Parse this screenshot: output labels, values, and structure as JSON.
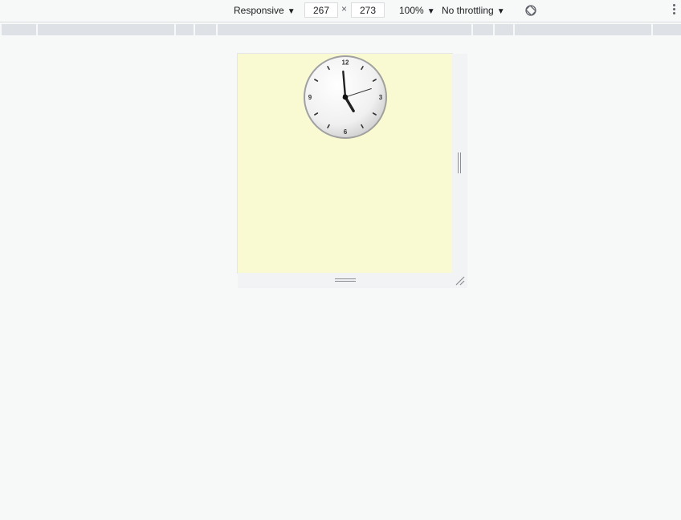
{
  "toolbar": {
    "device_mode": "Responsive",
    "width_value": "267",
    "height_value": "273",
    "times_sign": "×",
    "zoom": "100%",
    "throttling": "No throttling",
    "caret": "▼"
  },
  "icons": {
    "rotate": "rotate-icon",
    "more": "more-options-icon",
    "resize_corner": "resize-corner-icon"
  },
  "colors": {
    "page_background": "#fafad2",
    "devtools_background": "#f7f8f8",
    "media_bar": "#dee1e6"
  },
  "clock": {
    "numerals": [
      "12",
      "3",
      "6",
      "9"
    ],
    "time": "4:59:12"
  }
}
